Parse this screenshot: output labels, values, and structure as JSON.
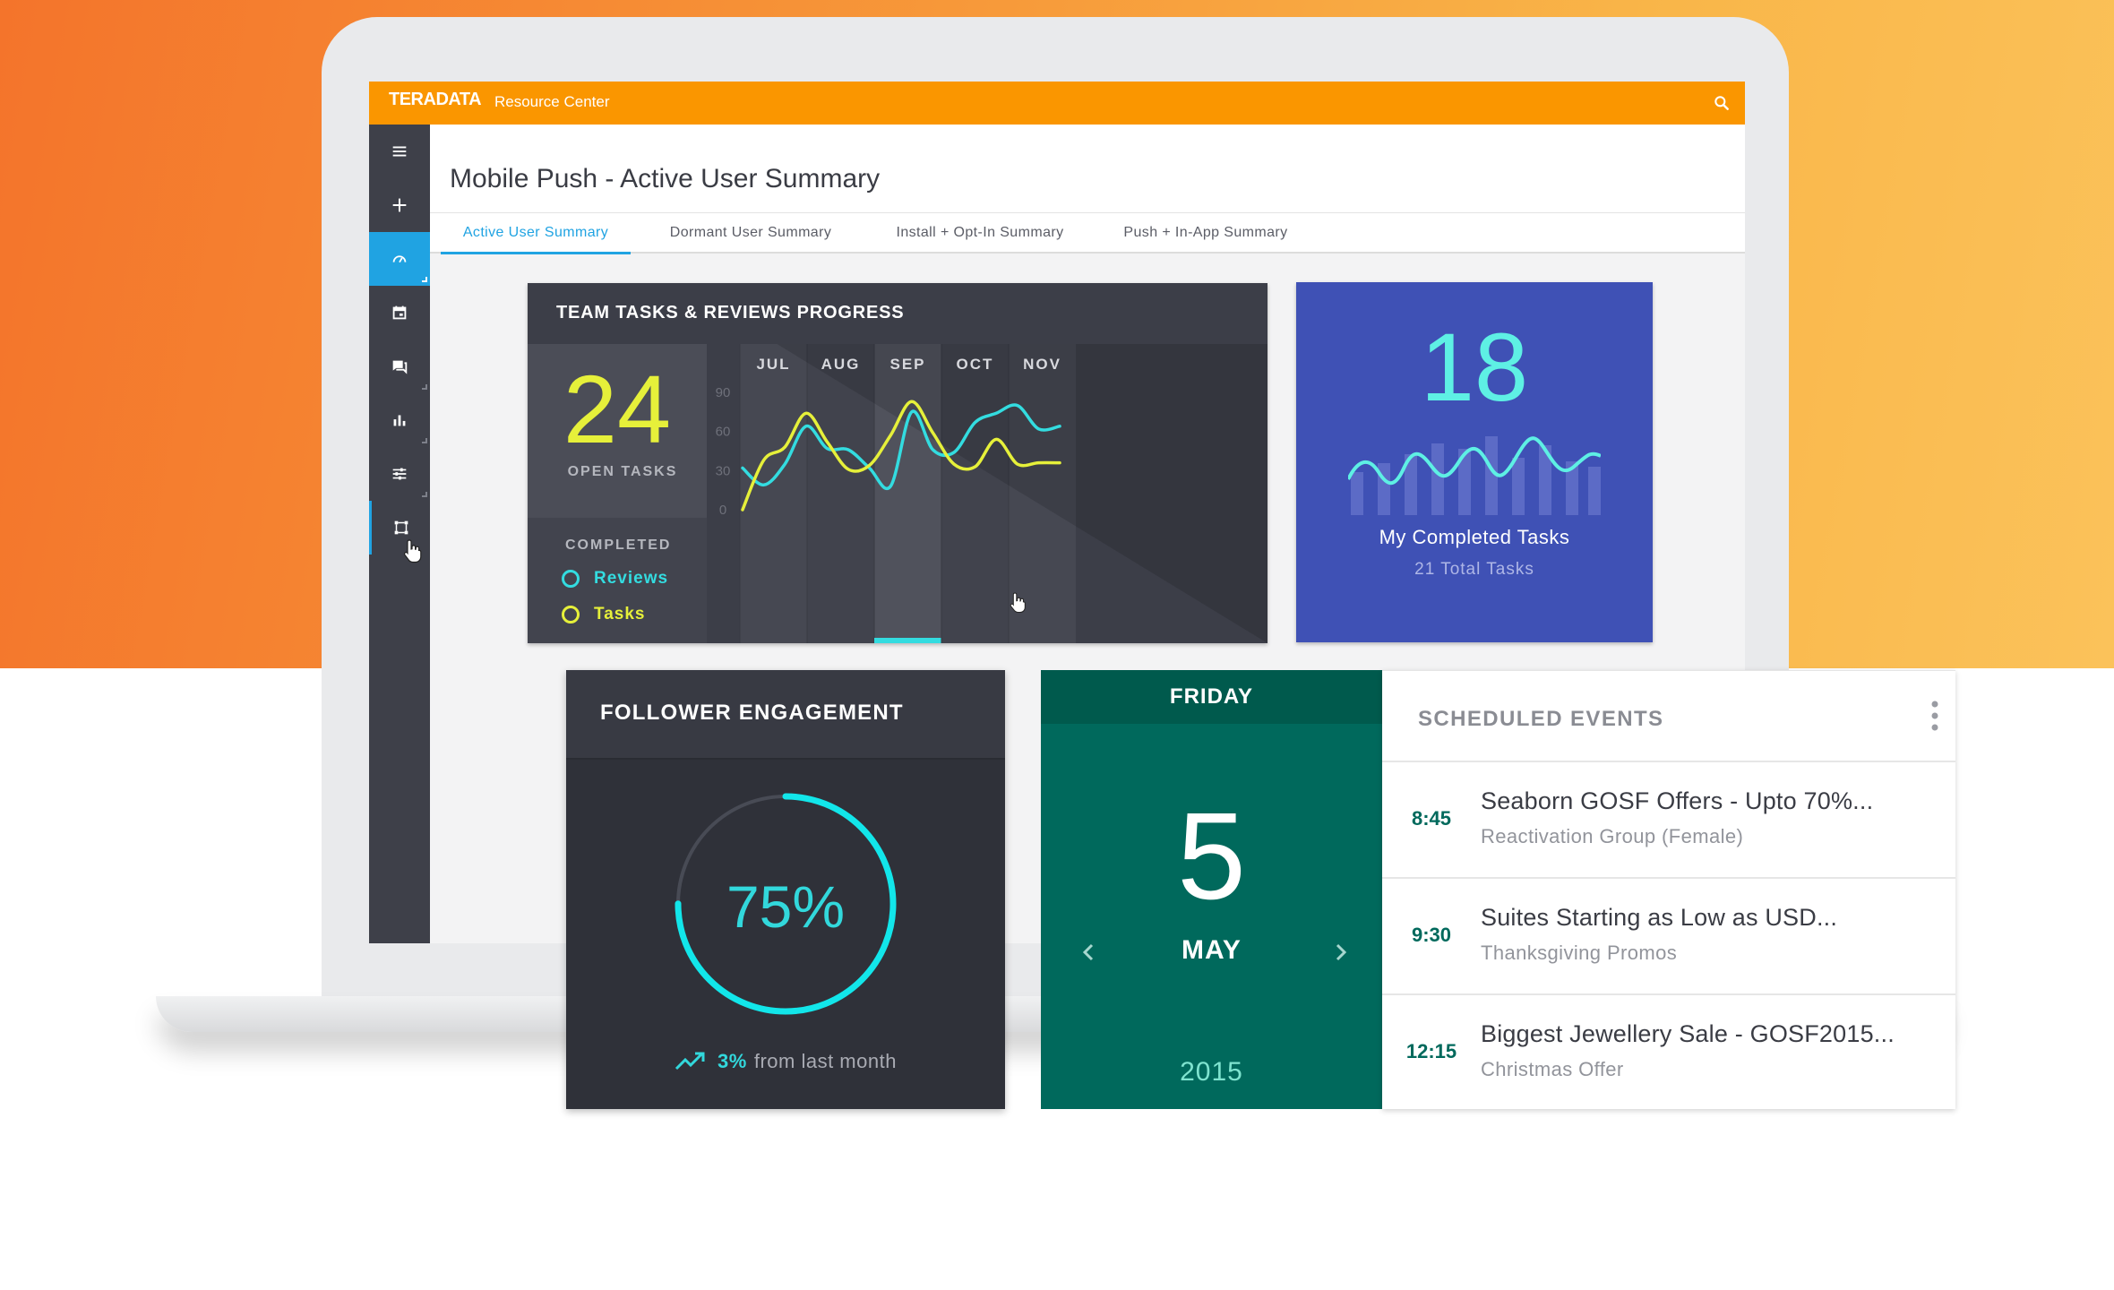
{
  "app": {
    "logo": "TERADATA",
    "name": "Resource Center"
  },
  "sidebar": {
    "items": [
      {
        "icon": "menu-icon"
      },
      {
        "icon": "plus-icon"
      },
      {
        "icon": "dashboard-gauge-icon",
        "state": "active"
      },
      {
        "icon": "calendar-icon"
      },
      {
        "icon": "chat-icon"
      },
      {
        "icon": "bar-chart-icon"
      },
      {
        "icon": "sliders-icon"
      },
      {
        "icon": "workflow-icon",
        "state": "current"
      }
    ]
  },
  "page": {
    "title": "Mobile Push - Active User Summary",
    "tabs": [
      {
        "label": "Active User Summary",
        "active": true
      },
      {
        "label": "Dormant User Summary",
        "active": false
      },
      {
        "label": "Install + Opt-In Summary",
        "active": false
      },
      {
        "label": "Push + In-App Summary",
        "active": false
      }
    ]
  },
  "team_card": {
    "title": "TEAM TASKS & REVIEWS PROGRESS",
    "open_count": "24",
    "open_label": "OPEN TASKS",
    "completed_label": "COMPLETED",
    "legend": [
      {
        "label": "Reviews",
        "color": "#33dce0"
      },
      {
        "label": "Tasks",
        "color": "#e6f03a"
      }
    ],
    "selected_month": "SEP"
  },
  "chart_data": {
    "type": "line",
    "categories": [
      "JUL",
      "AUG",
      "SEP",
      "OCT",
      "NOV"
    ],
    "ylim": [
      0,
      90
    ],
    "yticks": [
      "90",
      "60",
      "30",
      "0"
    ],
    "series": [
      {
        "name": "Reviews",
        "color": "#33dce0",
        "values": [
          32,
          19,
          35,
          64,
          47,
          46,
          32,
          18,
          75,
          46,
          44,
          67,
          74,
          80,
          62,
          64
        ]
      },
      {
        "name": "Tasks",
        "color": "#e6f03a",
        "values": [
          0,
          38,
          48,
          74,
          52,
          31,
          34,
          57,
          83,
          59,
          35,
          33,
          54,
          35,
          36,
          36
        ]
      }
    ]
  },
  "completed_card": {
    "count": "18",
    "label": "My Completed Tasks",
    "sub": "21 Total Tasks",
    "bg_color": "#3f51b5"
  },
  "follower_card": {
    "title": "FOLLOWER ENGAGEMENT",
    "percent": "75%",
    "progress": 0.75,
    "change": "3%",
    "change_suffix": "from last month"
  },
  "calendar": {
    "weekday": "FRIDAY",
    "day": "5",
    "month": "MAY",
    "year": "2015"
  },
  "events": {
    "title": "SCHEDULED EVENTS",
    "items": [
      {
        "time": "8:45",
        "name": "Seaborn GOSF Offers - Upto 70%...",
        "group": "Reactivation Group (Female)"
      },
      {
        "time": "9:30",
        "name": "Suites Starting as Low as USD...",
        "group": "Thanksgiving Promos"
      },
      {
        "time": "12:15",
        "name": "Biggest Jewellery Sale - GOSF2015...",
        "group": "Christmas Offer"
      }
    ]
  }
}
